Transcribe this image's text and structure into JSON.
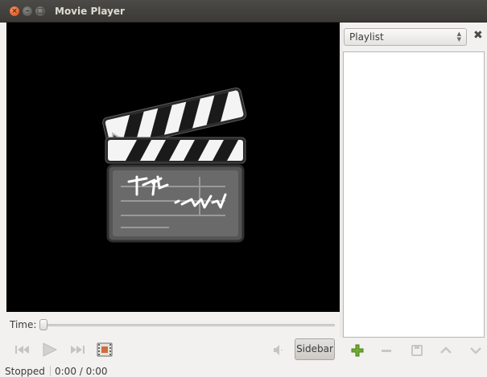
{
  "window": {
    "title": "Movie Player",
    "close_glyph": "×",
    "minimize_glyph": "–",
    "maximize_glyph": "□"
  },
  "video": {
    "placeholder_icon": "clapperboard-icon"
  },
  "sidebar": {
    "selector_value": "Playlist",
    "close_glyph": "✖",
    "playlist_items": [],
    "tools": [
      "add-icon",
      "remove-icon",
      "save-icon",
      "move-up-icon",
      "move-down-icon"
    ]
  },
  "seek": {
    "label": "Time:",
    "position": 0
  },
  "controls": {
    "icons": [
      "previous-icon",
      "play-icon",
      "next-icon",
      "fullscreen-icon",
      "volume-icon"
    ],
    "sidebar_label": "Sidebar"
  },
  "status": {
    "state": "Stopped",
    "time": "0:00 / 0:00"
  },
  "colors": {
    "titlebar": "#3c3b37",
    "close_button": "#e9632f",
    "video_background": "#000000",
    "add_icon": "#6fab2f"
  }
}
